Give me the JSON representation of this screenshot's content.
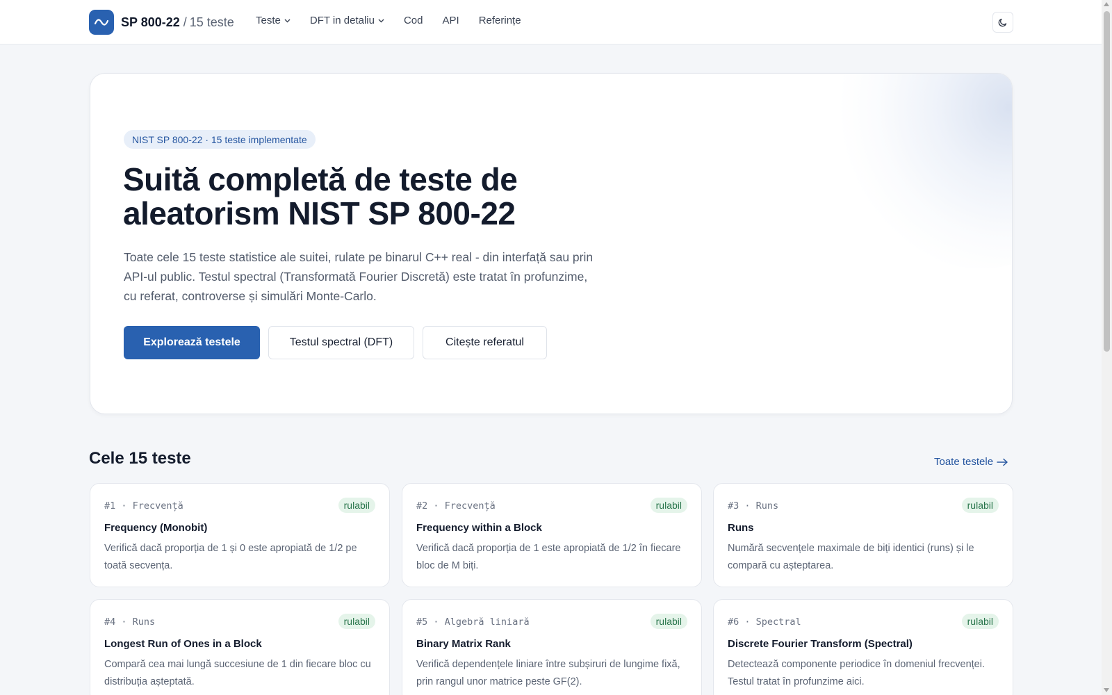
{
  "brand": {
    "name": "SP 800-22",
    "separator": "/",
    "subtitle": "15 teste"
  },
  "nav": {
    "items": [
      {
        "label": "Teste",
        "has_dropdown": true
      },
      {
        "label": "DFT in detaliu",
        "has_dropdown": true
      },
      {
        "label": "Cod",
        "has_dropdown": false
      },
      {
        "label": "API",
        "has_dropdown": false
      },
      {
        "label": "Referințe",
        "has_dropdown": false
      }
    ],
    "theme_toggle_icon": "moon-icon"
  },
  "hero": {
    "pill": "NIST SP 800-22 · 15 teste implementate",
    "title": "Suită completă de teste de aleatorism NIST SP 800-22",
    "description": "Toate cele 15 teste statistice ale suitei, rulate pe binarul C++ real - din interfață sau prin API-ul public. Testul spectral (Transformată Fourier Discretă) este tratat în profunzime, cu referat, controverse și simulări Monte-Carlo.",
    "buttons": {
      "primary": "Explorează testele",
      "dft": "Testul spectral (DFT)",
      "paper": "Citește referatul"
    }
  },
  "tests_section": {
    "title": "Cele 15 teste",
    "all_link": "Toate testele",
    "cards": [
      {
        "number": "#1",
        "category": "Frecvență",
        "badge": "rulabil",
        "title": "Frequency (Monobit)",
        "description": "Verifică dacă proporția de 1 și 0 este apropiată de 1/2 pe toată secvența."
      },
      {
        "number": "#2",
        "category": "Frecvență",
        "badge": "rulabil",
        "title": "Frequency within a Block",
        "description": "Verifică dacă proporția de 1 este apropiată de 1/2 în fiecare bloc de M biți."
      },
      {
        "number": "#3",
        "category": "Runs",
        "badge": "rulabil",
        "title": "Runs",
        "description": "Numără secvențele maximale de biți identici (runs) și le compară cu așteptarea."
      },
      {
        "number": "#4",
        "category": "Runs",
        "badge": "rulabil",
        "title": "Longest Run of Ones in a Block",
        "description": "Compară cea mai lungă succesiune de 1 din fiecare bloc cu distribuția așteptată."
      },
      {
        "number": "#5",
        "category": "Algebră liniară",
        "badge": "rulabil",
        "title": "Binary Matrix Rank",
        "description": "Verifică dependențele liniare între subșiruri de lungime fixă, prin rangul unor matrice peste GF(2)."
      },
      {
        "number": "#6",
        "category": "Spectral",
        "badge": "rulabil",
        "title": "Discrete Fourier Transform (Spectral)",
        "description": "Detectează componente periodice în domeniul frecvenței. Testul tratat în profunzime aici."
      }
    ]
  },
  "colors": {
    "accent": "#2961b0",
    "badge_bg": "#e5f4ea",
    "badge_text": "#27744a",
    "page_bg": "#f4f6f9"
  }
}
